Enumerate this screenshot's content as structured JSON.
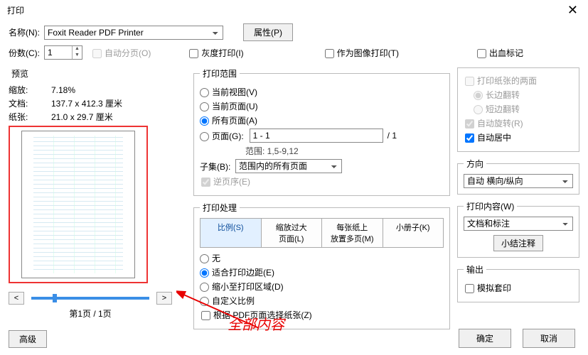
{
  "window": {
    "title": "打印"
  },
  "top": {
    "name_label": "名称(N):",
    "name_value": "Foxit Reader PDF Printer",
    "properties_btn": "属性(P)",
    "copies_label": "份数(C):",
    "copies_value": "1",
    "collate_label": "自动分页(O)",
    "gray_label": "灰度打印(I)",
    "image_label": "作为图像打印(T)",
    "bleed_label": "出血标记"
  },
  "preview": {
    "legend": "预览",
    "zoom_label": "缩放:",
    "zoom_value": "7.18%",
    "doc_label": "文档:",
    "doc_value": "137.7 x 412.3 厘米",
    "paper_label": "纸张:",
    "paper_value": "21.0 x 29.7 厘米",
    "page_text": "第1页 / 1页"
  },
  "range": {
    "legend": "打印范围",
    "current_view": "当前视图(V)",
    "current_page": "当前页面(U)",
    "all_pages": "所有页面(A)",
    "pages": "页面(G):",
    "pages_value": "1 - 1",
    "pages_total": "/ 1",
    "range_hint": "范围: 1,5-9,12",
    "subset_label": "子集(B):",
    "subset_value": "范围内的所有页面",
    "reverse_label": "逆页序(E)"
  },
  "handle": {
    "legend": "打印处理",
    "tabs": {
      "scale": "比例(S)",
      "tile": "缩放过大\n页面(L)",
      "multi": "每张纸上\n放置多页(M)",
      "book": "小册子(K)"
    },
    "none": "无",
    "fit": "适合打印边距(E)",
    "shrink": "缩小至打印区域(D)",
    "custom": "自定义比例",
    "choose_paper": "根据 PDF页面选择纸张(Z)"
  },
  "sides": {
    "both_label": "打印纸张的两面",
    "long_edge": "长边翻转",
    "short_edge": "短边翻转",
    "auto_rotate": "自动旋转(R)",
    "auto_center": "自动居中"
  },
  "orient": {
    "legend": "方向",
    "value": "自动 横向/纵向"
  },
  "content": {
    "legend": "打印内容(W)",
    "value": "文档和标注",
    "summary_btn": "小结注释"
  },
  "output": {
    "legend": "输出",
    "simulate": "模拟套印"
  },
  "buttons": {
    "advanced": "高级",
    "ok": "确定",
    "cancel": "取消"
  },
  "annotation": "全部内容"
}
